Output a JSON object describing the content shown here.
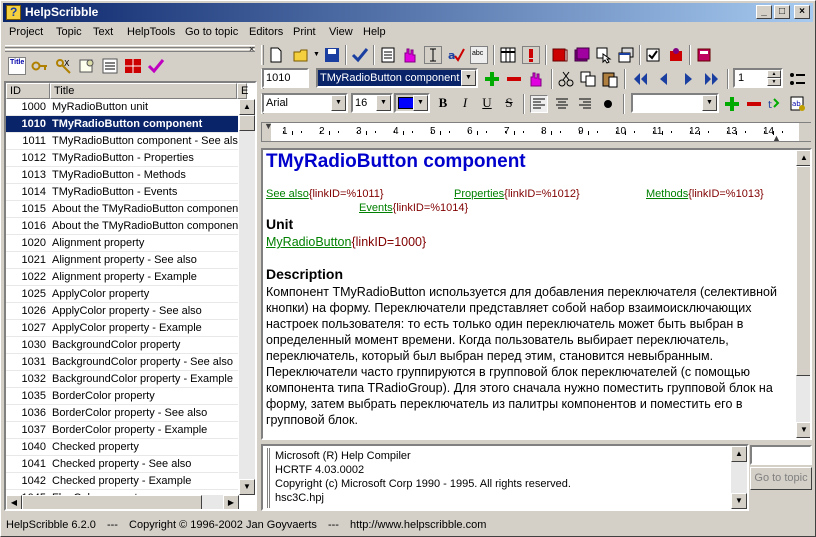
{
  "window": {
    "title": "HelpScribble"
  },
  "title_buttons": {
    "min": "_",
    "max": "□",
    "close": "×"
  },
  "menu": [
    "Project",
    "Topic",
    "Text",
    "HelpTools",
    "Go to topic",
    "Editors",
    "Print",
    "View",
    "Help"
  ],
  "list": {
    "headers": {
      "id": "ID",
      "title": "Title",
      "extra": "E"
    },
    "rows": [
      {
        "id": "1000",
        "title": "MyRadioButton unit"
      },
      {
        "id": "1010",
        "title": "TMyRadioButton component",
        "selected": true
      },
      {
        "id": "1011",
        "title": "TMyRadioButton component - See also"
      },
      {
        "id": "1012",
        "title": "TMyRadioButton - Properties"
      },
      {
        "id": "1013",
        "title": "TMyRadioButton - Methods"
      },
      {
        "id": "1014",
        "title": "TMyRadioButton - Events"
      },
      {
        "id": "1015",
        "title": "About the TMyRadioButton component"
      },
      {
        "id": "1016",
        "title": "About the TMyRadioButton component"
      },
      {
        "id": "1020",
        "title": "Alignment property"
      },
      {
        "id": "1021",
        "title": "Alignment property - See also"
      },
      {
        "id": "1022",
        "title": "Alignment property - Example"
      },
      {
        "id": "1025",
        "title": "ApplyColor property"
      },
      {
        "id": "1026",
        "title": "ApplyColor property - See also"
      },
      {
        "id": "1027",
        "title": "ApplyColor property - Example"
      },
      {
        "id": "1030",
        "title": "BackgroundColor property"
      },
      {
        "id": "1031",
        "title": "BackgroundColor property - See also"
      },
      {
        "id": "1032",
        "title": "BackgroundColor property - Example"
      },
      {
        "id": "1035",
        "title": "BorderColor property"
      },
      {
        "id": "1036",
        "title": "BorderColor property - See also"
      },
      {
        "id": "1037",
        "title": "BorderColor property - Example"
      },
      {
        "id": "1040",
        "title": "Checked property"
      },
      {
        "id": "1041",
        "title": "Checked property - See also"
      },
      {
        "id": "1042",
        "title": "Checked property - Example"
      },
      {
        "id": "1045",
        "title": "FlagColor property"
      }
    ]
  },
  "topic_bar": {
    "id_value": "1010",
    "title_value": "TMyRadioButton component",
    "page_value": "1"
  },
  "format_bar": {
    "font": "Arial",
    "size": "16",
    "bold": "B",
    "italic": "I",
    "underline": "U",
    "strike": "S"
  },
  "ruler": [
    "1",
    "2",
    "3",
    "4",
    "5",
    "6",
    "7",
    "8",
    "9",
    "10",
    "11",
    "12",
    "13",
    "14"
  ],
  "editor": {
    "heading": "TMyRadioButton component",
    "see_also": "See also",
    "see_also_id": "{linkID=%1011}",
    "properties": "Properties",
    "properties_id": "{linkID=%1012}",
    "methods": "Methods",
    "methods_id": "{linkID=%1013}",
    "events": "Events",
    "events_id": "{linkID=%1014}",
    "unit_heading": "Unit",
    "unit_link": "MyRadioButton",
    "unit_id": "{linkID=1000}",
    "desc_heading": "Description",
    "desc_text": "Компонент TMyRadioButton используется для добавления переключателя (селективной кнопки) на форму. Переключатели представляет собой набор взаимоисключающих настроек пользователя: то есть только один переключатель может быть выбран в определенный момент времени. Когда пользователь выбирает переключатель, переключатель, который был выбран перед этим, становится невыбранным. Переключатели часто группируются в групповой блок переключателей (с помощью компонента типа TRadioGroup). Для этого сначала нужно поместить групповой блок на форму, затем выбрать переключатель из палитры компонентов и поместить его в групповой блок."
  },
  "output": {
    "lines": [
      "Microsoft (R) Help Compiler",
      "HCRTF 4.03.0002",
      "Copyright (c) Microsoft Corp 1990 - 1995. All rights reserved.",
      "hsc3C.hpj"
    ]
  },
  "goto_button": "Go to topic",
  "status": {
    "version": "HelpScribble 6.2.0",
    "sep1": "---",
    "copyright": "Copyright © 1996-2002  Jan Goyvaerts",
    "sep2": "---",
    "url": "http://www.helpscribble.com"
  }
}
